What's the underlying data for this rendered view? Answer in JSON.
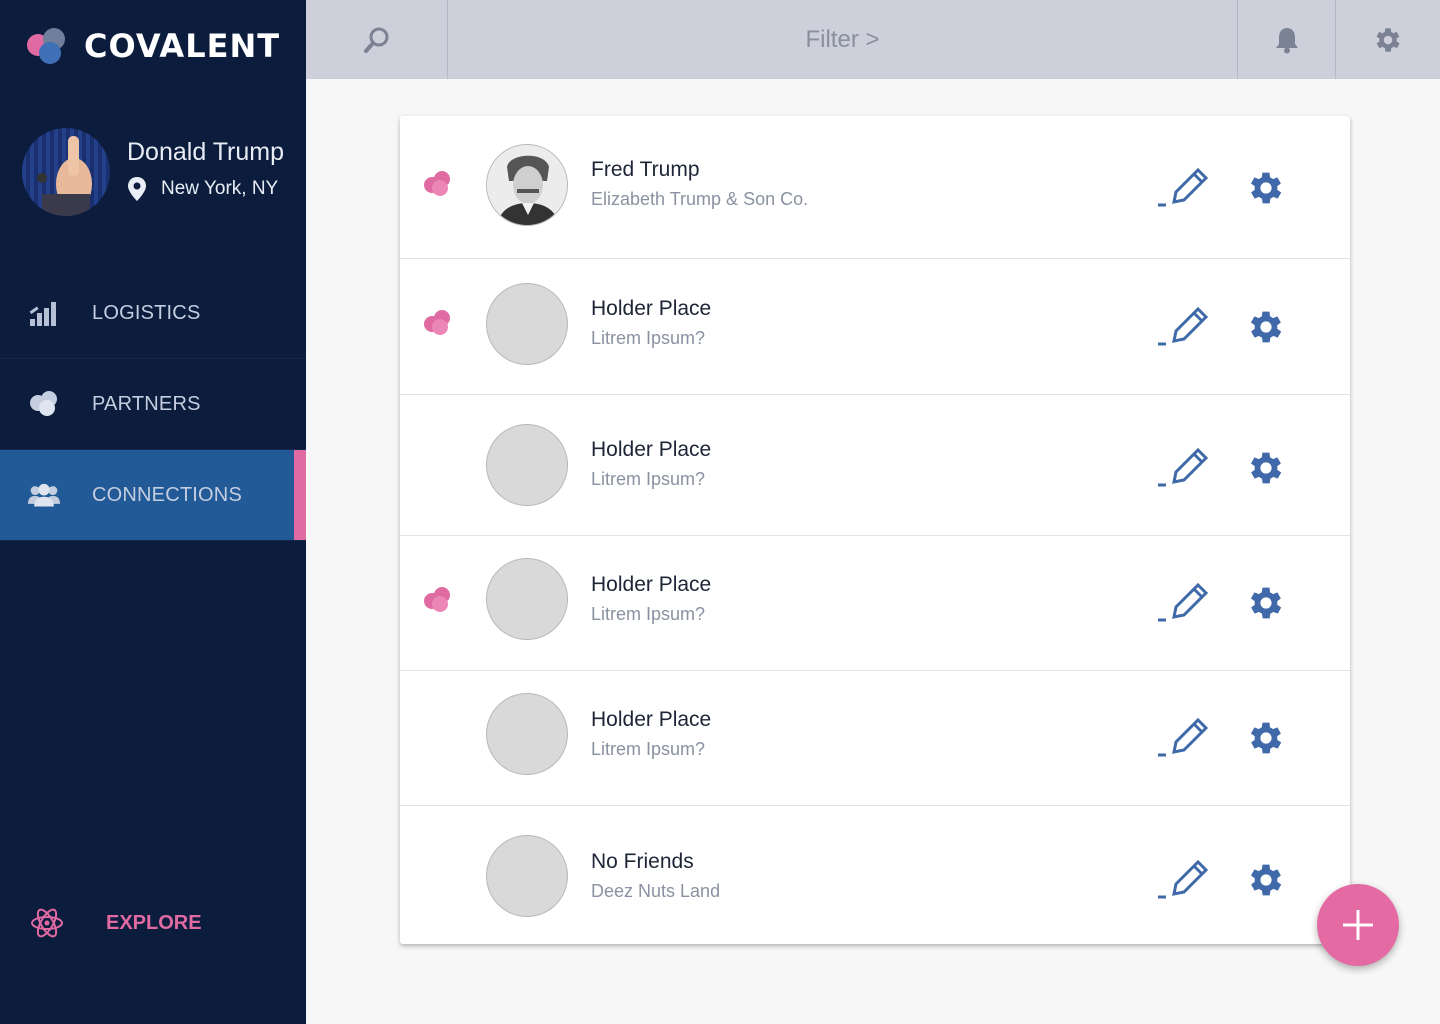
{
  "brand": {
    "name": "COVALENT"
  },
  "profile": {
    "name": "Donald Trump",
    "location": "New York, NY"
  },
  "nav": {
    "items": [
      {
        "label": "LOGISTICS",
        "icon": "bar-chart-icon"
      },
      {
        "label": "PARTNERS",
        "icon": "partners-icon"
      },
      {
        "label": "CONNECTIONS",
        "icon": "users-icon",
        "active": true
      }
    ],
    "explore_label": "EXPLORE"
  },
  "topbar": {
    "filter_label": "Filter >"
  },
  "connections": [
    {
      "name": "Fred Trump",
      "subtitle": "Elizabeth Trump & Son Co.",
      "badge": true,
      "photo": true
    },
    {
      "name": "Holder Place",
      "subtitle": "Litrem Ipsum?",
      "badge": true,
      "photo": false
    },
    {
      "name": "Holder Place",
      "subtitle": "Litrem Ipsum?",
      "badge": false,
      "photo": false
    },
    {
      "name": "Holder Place",
      "subtitle": "Litrem Ipsum?",
      "badge": true,
      "photo": false
    },
    {
      "name": "Holder Place",
      "subtitle": "Litrem Ipsum?",
      "badge": false,
      "photo": false
    },
    {
      "name": "No Friends",
      "subtitle": "Deez Nuts Land",
      "badge": false,
      "photo": false
    }
  ],
  "colors": {
    "sidebar": "#0b1c3d",
    "active_nav": "#215a96",
    "accent_pink": "#e06aa2",
    "icon_blue": "#3f69a8",
    "topbar": "#cdd0db"
  }
}
